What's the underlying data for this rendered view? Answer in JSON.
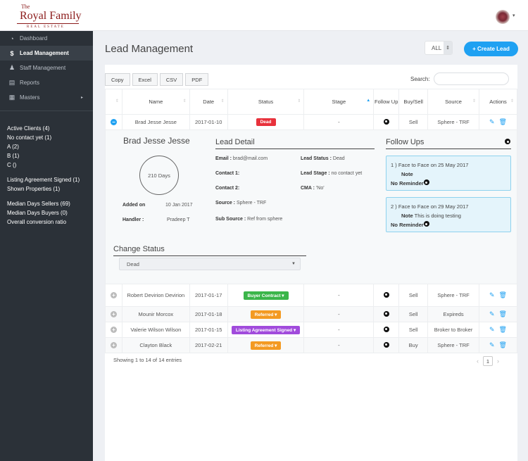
{
  "brand": {
    "the": "The",
    "name": "Royal Family",
    "sub": "REAL ESTATE"
  },
  "colors": {
    "accent": "#1fa1f2",
    "sidebar": "#2b3138",
    "dead": "#e8323c",
    "buyer_contract": "#3bb54a",
    "referred": "#f39a22",
    "listing_signed": "#a14bdc"
  },
  "sidebar": {
    "items": [
      {
        "label": "Dashboard",
        "icon": "dashboard-icon"
      },
      {
        "label": "Lead Management",
        "icon": "dollar-icon",
        "active": true
      },
      {
        "label": "Staff Management",
        "icon": "user-icon"
      },
      {
        "label": "Reports",
        "icon": "reports-icon"
      },
      {
        "label": "Masters",
        "icon": "grid-icon",
        "has_submenu": true
      }
    ],
    "stats_group1": [
      "Active Clients (4)",
      "No contact yet (1)",
      "A (2)",
      "B (1)",
      "C ()"
    ],
    "stats_group2": [
      "Listing Agreement Signed (1)",
      "Shown Properties (1)"
    ],
    "stats_group3": [
      "Median Days Sellers (69)",
      "Median Days Buyers (0)",
      "Overall conversion ratio"
    ]
  },
  "header": {
    "title": "Lead Management",
    "filter_value": "ALL",
    "create_label": "+ Create Lead"
  },
  "toolbar": {
    "buttons": [
      "Copy",
      "Excel",
      "CSV",
      "PDF"
    ],
    "search_label": "Search:",
    "search_value": ""
  },
  "table": {
    "columns": [
      "",
      "Name",
      "Date",
      "Status",
      "Stage",
      "Follow Up",
      "Buy/Sell",
      "Source",
      "Actions"
    ],
    "rows": [
      {
        "name": "Brad Jesse Jesse",
        "date": "2017-01-10",
        "status": "Dead",
        "status_color": "#e8323c",
        "stage": "-",
        "buy_sell": "Sell",
        "source": "Sphere - TRF",
        "expanded": true
      },
      {
        "name": "Robert Devirion Devirion",
        "date": "2017-01-17",
        "status": "Buyer Contract ▾",
        "status_color": "#3bb54a",
        "stage": "-",
        "buy_sell": "Sell",
        "source": "Sphere - TRF"
      },
      {
        "name": "Mounir Morcox",
        "date": "2017-01-18",
        "status": "Referred ▾",
        "status_color": "#f39a22",
        "stage": "-",
        "buy_sell": "Sell",
        "source": "Expireds"
      },
      {
        "name": "Valerie Wilson Wilson",
        "date": "2017-01-15",
        "status": "Listing Agreement Signed ▾",
        "status_color": "#a14bdc",
        "stage": "-",
        "buy_sell": "Sell",
        "source": "Broker to Broker"
      },
      {
        "name": "Clayton Black",
        "date": "2017-02-21",
        "status": "Referred ▾",
        "status_color": "#f39a22",
        "stage": "-",
        "buy_sell": "Buy",
        "source": "Sphere - TRF"
      }
    ]
  },
  "detail": {
    "name": "Brad Jesse Jesse",
    "days": "210 Days",
    "added_label": "Added on",
    "added_value": "10 Jan 2017",
    "handler_label": "Handler :",
    "handler_value": "Pradeep T",
    "lead_detail_title": "Lead Detail",
    "email_label": "Email :",
    "email_value": "brad@mail.com",
    "contact1_label": "Contact 1:",
    "contact2_label": "Contact 2:",
    "source_label": "Source :",
    "source_value": "Sphere - TRF",
    "subsource_label": "Sub Source :",
    "subsource_value": "Ref from sphere",
    "status_label": "Lead Status :",
    "status_value": "Dead",
    "stage_label": "Lead Stage :",
    "stage_value": "no contact yet",
    "cma_label": "CMA :",
    "cma_value": "'No'",
    "followups_title": "Follow Ups",
    "followups": [
      {
        "title": "1 ) Face to Face on 25 May 2017",
        "note_label": "Note",
        "note": "",
        "reminder": "No Reminder"
      },
      {
        "title": "2 ) Face to Face on 29 May 2017",
        "note_label": "Note",
        "note": "This is doing testing",
        "reminder": "No Reminder"
      }
    ],
    "change_status_title": "Change Status",
    "change_status_value": "Dead"
  },
  "footer": {
    "info": "Showing 1 to 14 of 14 entries",
    "page": "1"
  }
}
